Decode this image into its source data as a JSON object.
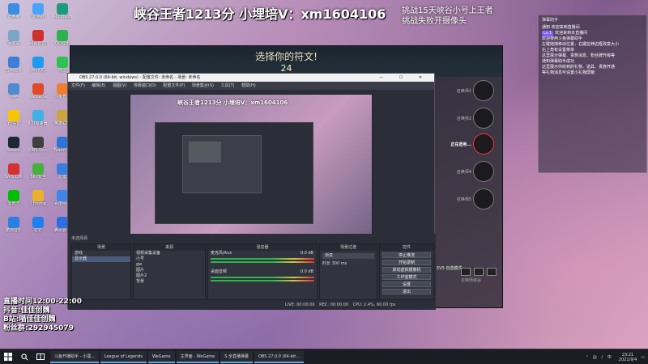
{
  "desktop_icons": [
    {
      "label": "此电脑",
      "color": "#3a8ee6"
    },
    {
      "label": "此电脑",
      "color": "#4aa3ff"
    },
    {
      "label": "Microsoft Edge",
      "color": "#1a9c7a"
    },
    {
      "label": "回收站",
      "color": "#7aa6c8"
    },
    {
      "label": "网易云音乐",
      "color": "#d03030"
    },
    {
      "label": "QQ音乐",
      "color": "#2bb24c"
    },
    {
      "label": "控制面板",
      "color": "#3d7fd6"
    },
    {
      "label": "腾讯QQ",
      "color": "#1e9bf0"
    },
    {
      "label": "微信",
      "color": "#2ec251"
    },
    {
      "label": "网络",
      "color": "#4f8bd0"
    },
    {
      "label": "WeGame",
      "color": "#e04a2a"
    },
    {
      "label": "斗鱼直播",
      "color": "#f08030"
    },
    {
      "label": "YY语音",
      "color": "#f7c600"
    },
    {
      "label": "UU加速器",
      "color": "#3fb0e8"
    },
    {
      "label": "英雄联盟",
      "color": "#c9a640"
    },
    {
      "label": "Steam",
      "color": "#1b2838"
    },
    {
      "label": "OBS Studio",
      "color": "#404040"
    },
    {
      "label": "TeamViewer",
      "color": "#2c75d6"
    },
    {
      "label": "WPS Office",
      "color": "#d63030"
    },
    {
      "label": "360安全",
      "color": "#47b03a"
    },
    {
      "label": "迅雷",
      "color": "#3a7de0"
    },
    {
      "label": "爱奇艺",
      "color": "#00be06"
    },
    {
      "label": "Chrome",
      "color": "#e8b32a"
    },
    {
      "label": "百度网盘",
      "color": "#3d86e8"
    },
    {
      "label": "酷狗音乐",
      "color": "#2a80e0"
    },
    {
      "label": "钉钉",
      "color": "#2080f0"
    },
    {
      "label": "腾讯会议",
      "color": "#2d6fe0"
    }
  ],
  "stream_banner": "峡谷王者1213分 小埋培V：xm1604106",
  "challenge_lines": [
    "挑战15天峡谷小号上王者",
    "挑战失败开摄像头"
  ],
  "game": {
    "title": "选择你的符文!",
    "timer": "24",
    "slot_labels": [
      "召唤师1",
      "召唤师2",
      "正在选用...",
      "召唤师4",
      "召唤师5"
    ],
    "mode": "5V5 自选模式",
    "footer": "召唤师峡谷"
  },
  "obs": {
    "title": "OBS 27.0.0 (64-bit, windows) - 配置文件: 未命名 - 场景: 未命名",
    "menu": [
      "文件(F)",
      "编辑(E)",
      "视图(V)",
      "停靠窗口(D)",
      "配置文件(P)",
      "场景集合(S)",
      "工具(T)",
      "帮助(H)"
    ],
    "preview_banner": "峡谷王者1213分 小埋培V：xm1604106",
    "scene_status": "未选择源",
    "docks": {
      "scenes": {
        "title": "场景",
        "items": [
          "游戏",
          "显示器"
        ]
      },
      "sources": {
        "title": "来源",
        "items": [
          "视频采集设备",
          "小号",
          "gw",
          "图片",
          "图片2",
          "背景"
        ]
      },
      "mixer": {
        "title": "混音器",
        "items": [
          {
            "name": "麦克风/Aux",
            "level": "0.0 dB"
          },
          {
            "name": "桌面音频",
            "level": "0.0 dB"
          }
        ]
      },
      "transitions": {
        "title": "场景过渡",
        "type": "渐变",
        "duration_label": "时长",
        "duration": "300 ms"
      },
      "controls": {
        "title": "控件",
        "buttons": [
          "停止推流",
          "开始录制",
          "启动虚拟摄像机",
          "工作室模式",
          "设置",
          "退出"
        ]
      }
    },
    "status": {
      "live": "LIVE: 00:00:00",
      "rec": "REC: 00:00:00",
      "cpu": "CPU: 2.4%, 60.00 fps"
    }
  },
  "chat": {
    "header": "弹幕助手",
    "lines": [
      {
        "badge": "",
        "text": "通知 欢迎来到直播间"
      },
      {
        "badge": "Lv.1",
        "text": "欢迎来到本直播间"
      },
      {
        "badge": "",
        "text": "欢迎使用斗鱼弹幕助手"
      },
      {
        "badge": "",
        "text": "左键拖拽移动位置，右键拉伸边框改变大小"
      },
      {
        "badge": "",
        "text": "右上角有设置菜单"
      },
      {
        "badge": "",
        "text": "这里展示弹幕、贵族消息、粉丝牌升级等"
      },
      {
        "badge": "",
        "text": "通知弹幕助手成功"
      },
      {
        "badge": "",
        "text": "这里展示你收到的礼物、道具、贵族开通"
      },
      {
        "badge": "",
        "text": "等礼物消息可设置小礼物屏蔽"
      }
    ]
  },
  "schedule": [
    "直播时间12:00-22:00",
    "抖音:佳佳创魏",
    "B站:喵佳佳创魏",
    "粉丝群:292945079"
  ],
  "taskbar": {
    "apps": [
      "斗鱼开播助手 - 小埋...",
      "League of Legends",
      "WeGame",
      "主界面 - WeGame",
      "S 全直播弹幕",
      "OBS 27.0.0 (64-bit..."
    ],
    "time": "23:21",
    "date": "2021/9/4"
  }
}
